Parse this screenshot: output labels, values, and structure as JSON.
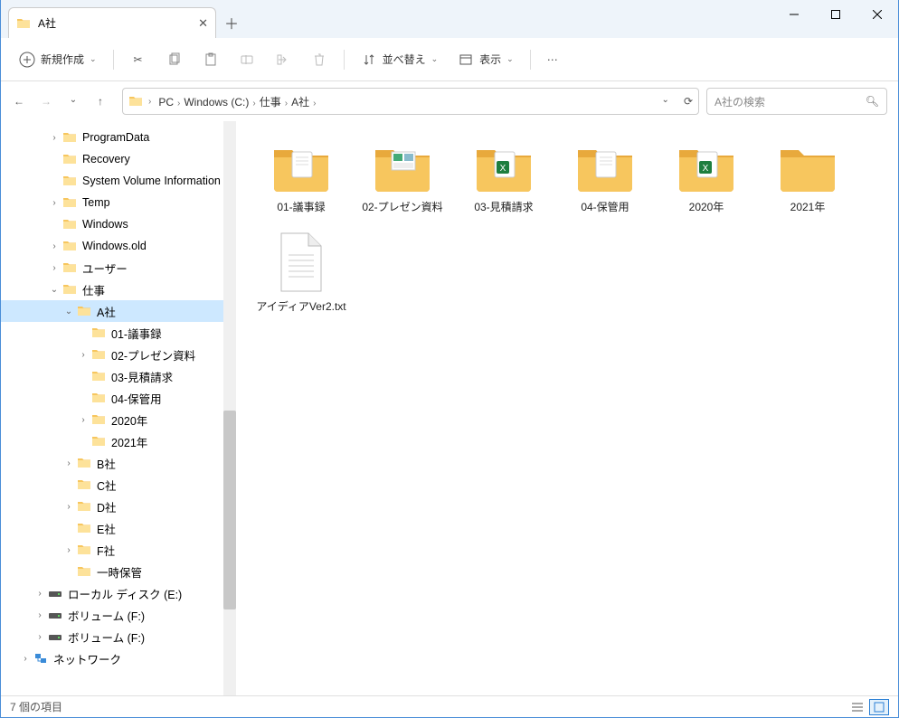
{
  "window": {
    "tab_title": "A社"
  },
  "toolbar": {
    "new_label": "新規作成",
    "sort_label": "並べ替え",
    "view_label": "表示"
  },
  "breadcrumb": [
    "PC",
    "Windows (C:)",
    "仕事",
    "A社"
  ],
  "search": {
    "placeholder": "A社の検索"
  },
  "tree": [
    {
      "depth": 1,
      "chev": ">",
      "icon": "folder",
      "label": "ProgramData"
    },
    {
      "depth": 1,
      "chev": "",
      "icon": "folder",
      "label": "Recovery"
    },
    {
      "depth": 1,
      "chev": "",
      "icon": "folder",
      "label": "System Volume Information"
    },
    {
      "depth": 1,
      "chev": ">",
      "icon": "folder",
      "label": "Temp"
    },
    {
      "depth": 1,
      "chev": "",
      "icon": "folder",
      "label": "Windows"
    },
    {
      "depth": 1,
      "chev": ">",
      "icon": "folder",
      "label": "Windows.old"
    },
    {
      "depth": 1,
      "chev": ">",
      "icon": "folder",
      "label": "ユーザー"
    },
    {
      "depth": 1,
      "chev": "v",
      "icon": "folder",
      "label": "仕事"
    },
    {
      "depth": 2,
      "chev": "v",
      "icon": "folder",
      "label": "A社",
      "selected": true
    },
    {
      "depth": 3,
      "chev": "",
      "icon": "folder",
      "label": "01-議事録"
    },
    {
      "depth": 3,
      "chev": ">",
      "icon": "folder",
      "label": "02-プレゼン資料"
    },
    {
      "depth": 3,
      "chev": "",
      "icon": "folder",
      "label": "03-見積請求"
    },
    {
      "depth": 3,
      "chev": "",
      "icon": "folder",
      "label": "04-保管用"
    },
    {
      "depth": 3,
      "chev": ">",
      "icon": "folder",
      "label": "2020年"
    },
    {
      "depth": 3,
      "chev": "",
      "icon": "folder",
      "label": "2021年"
    },
    {
      "depth": 2,
      "chev": ">",
      "icon": "folder",
      "label": "B社"
    },
    {
      "depth": 2,
      "chev": "",
      "icon": "folder",
      "label": "C社"
    },
    {
      "depth": 2,
      "chev": ">",
      "icon": "folder",
      "label": "D社"
    },
    {
      "depth": 2,
      "chev": "",
      "icon": "folder",
      "label": "E社"
    },
    {
      "depth": 2,
      "chev": ">",
      "icon": "folder",
      "label": "F社"
    },
    {
      "depth": 2,
      "chev": "",
      "icon": "folder",
      "label": "一時保管"
    },
    {
      "depth": 0,
      "chev": ">",
      "icon": "drive",
      "label": "ローカル ディスク (E:)"
    },
    {
      "depth": 0,
      "chev": ">",
      "icon": "drive",
      "label": "ボリューム (F:)"
    },
    {
      "depth": 0,
      "chev": ">",
      "icon": "drive",
      "label": "ボリューム (F:)"
    },
    {
      "depth": -1,
      "chev": ">",
      "icon": "network",
      "label": "ネットワーク"
    }
  ],
  "items": [
    {
      "type": "folder-doc",
      "label": "01-議事録"
    },
    {
      "type": "folder-img",
      "label": "02-プレゼン資料"
    },
    {
      "type": "folder-excel",
      "label": "03-見積請求"
    },
    {
      "type": "folder-doc",
      "label": "04-保管用"
    },
    {
      "type": "folder-excel",
      "label": "2020年"
    },
    {
      "type": "folder",
      "label": "2021年"
    },
    {
      "type": "txt",
      "label": "アイディアVer2.txt"
    }
  ],
  "status": {
    "count_text": "7 個の項目"
  }
}
